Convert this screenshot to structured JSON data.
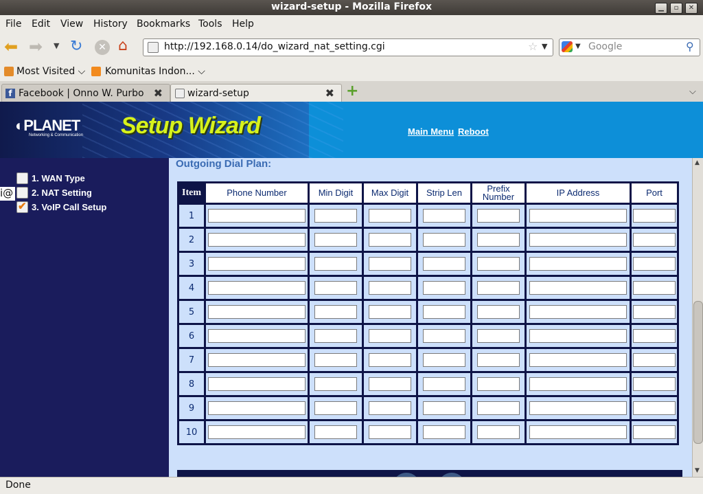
{
  "window": {
    "title": "wizard-setup - Mozilla Firefox"
  },
  "menubar": {
    "items": [
      "File",
      "Edit",
      "View",
      "History",
      "Bookmarks",
      "Tools",
      "Help"
    ]
  },
  "navbar": {
    "url": "http://192.168.0.14/do_wizard_nat_setting.cgi",
    "search_placeholder": "Google"
  },
  "bookmarks": {
    "items": [
      "Most Visited",
      "Komunitas Indon..."
    ]
  },
  "tabs": [
    {
      "label": "Facebook | Onno W. Purbo"
    },
    {
      "label": "wizard-setup"
    }
  ],
  "header": {
    "logo": "PLANET",
    "logo_sub": "Networking & Communication",
    "title": "Setup Wizard",
    "links": [
      "Main Menu",
      "Reboot"
    ]
  },
  "sidebar": {
    "steps": [
      {
        "label": "1. WAN Type",
        "checked": false
      },
      {
        "label": "2. NAT Setting",
        "checked": false
      },
      {
        "label": "3. VoIP Call Setup",
        "checked": true
      }
    ],
    "fragment": "i@"
  },
  "main": {
    "section_title": "Outgoing Dial Plan:",
    "columns": [
      "Item",
      "Phone Number",
      "Min Digit",
      "Max Digit",
      "Strip Len",
      "Prefix Number",
      "IP Address",
      "Port"
    ],
    "rows": [
      "1",
      "2",
      "3",
      "4",
      "5",
      "6",
      "7",
      "8",
      "9",
      "10"
    ]
  },
  "status": {
    "text": "Done"
  },
  "colors": {
    "header_blue": "#0d8fd8",
    "sidebar_navy": "#1a1c5c",
    "content_bg": "#cde0fb",
    "wizard_title": "#d7f21c"
  }
}
